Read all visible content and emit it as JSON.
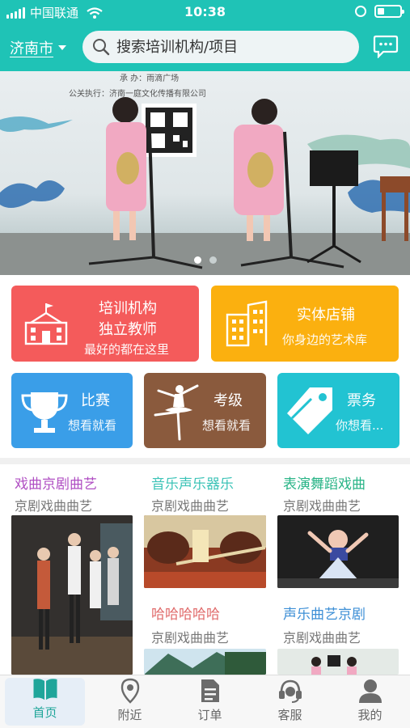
{
  "status_bar": {
    "carrier": "中国联通",
    "time": "10:38"
  },
  "header": {
    "city": "济南市",
    "search_placeholder": "搜索培训机构/项目"
  },
  "banner": {
    "lines": [
      "承 办：雨滴广场",
      "公关执行：济南一庭文化传播有限公司"
    ],
    "slides": 2,
    "active_slide": 1
  },
  "features": {
    "institution": {
      "line1": "培训机构",
      "line2": "独立教师",
      "subtitle": "最好的都在这里",
      "color": "#f45b5b"
    },
    "store": {
      "title": "实体店铺",
      "subtitle": "你身边的艺术库",
      "color": "#fbb00f"
    },
    "contest": {
      "title": "比赛",
      "subtitle": "想看就看",
      "color": "#3a9ee8"
    },
    "exam": {
      "title": "考级",
      "subtitle": "想看就看",
      "color": "#8a5a3d"
    },
    "tickets": {
      "title": "票务",
      "subtitle": "你想看...",
      "color": "#22c3d2"
    }
  },
  "categories": [
    {
      "title": "戏曲京剧曲艺",
      "subtitle": "京剧戏曲曲艺",
      "color": "#b04fc3"
    },
    {
      "title": "音乐声乐器乐",
      "subtitle": "京剧戏曲曲艺",
      "color": "#3cc3b7"
    },
    {
      "title": "表演舞蹈戏曲",
      "subtitle": "京剧戏曲曲艺",
      "color": "#29b487"
    },
    {
      "title": "哈哈哈哈哈",
      "subtitle": "京剧戏曲曲艺",
      "color": "#e06b6b"
    },
    {
      "title": "声乐曲艺京剧",
      "subtitle": "京剧戏曲曲艺",
      "color": "#3d8fd6"
    }
  ],
  "tabs": [
    {
      "label": "首页",
      "icon": "book-icon"
    },
    {
      "label": "附近",
      "icon": "location-pin-icon"
    },
    {
      "label": "订单",
      "icon": "document-icon"
    },
    {
      "label": "客服",
      "icon": "headset-icon"
    },
    {
      "label": "我的",
      "icon": "user-icon"
    }
  ],
  "accent_color": "#1fc3b6"
}
